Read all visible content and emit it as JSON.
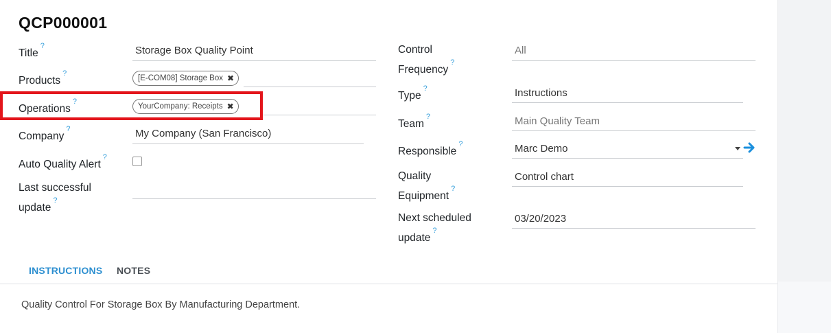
{
  "record": {
    "title": "QCP000001"
  },
  "left_fields": {
    "title": {
      "label": "Title",
      "value": "Storage Box Quality Point"
    },
    "products": {
      "label": "Products",
      "tag": "[E-COM08] Storage Box"
    },
    "operations": {
      "label": "Operations",
      "tag": "YourCompany: Receipts"
    },
    "company": {
      "label": "Company",
      "value": "My Company (San Francisco)"
    },
    "auto_alert": {
      "label": "Auto Quality Alert",
      "checked": false
    },
    "last_update": {
      "label_line1": "Last successful",
      "label_line2": "update",
      "value": ""
    }
  },
  "right_fields": {
    "control_frequency": {
      "label_line1": "Control",
      "label_line2": "Frequency",
      "value": "All"
    },
    "type": {
      "label": "Type",
      "value": "Instructions"
    },
    "team": {
      "label": "Team",
      "value": "Main Quality Team"
    },
    "responsible": {
      "label": "Responsible",
      "value": "Marc Demo"
    },
    "quality_equipment": {
      "label_line1": "Quality",
      "label_line2": "Equipment",
      "value": "Control chart"
    },
    "next_update": {
      "label_line1": "Next scheduled",
      "label_line2": "update",
      "value": "03/20/2023"
    }
  },
  "help_marker": "?",
  "tag_remove_glyph": "✖",
  "tabs": [
    {
      "label": "INSTRUCTIONS",
      "active": true
    },
    {
      "label": "NOTES",
      "active": false
    }
  ],
  "instructions": {
    "text": "Quality Control For Storage Box By Manufacturing Department."
  },
  "colors": {
    "accent": "#2d8fd0",
    "highlight": "#e3151b",
    "help": "#3aa1dc"
  }
}
